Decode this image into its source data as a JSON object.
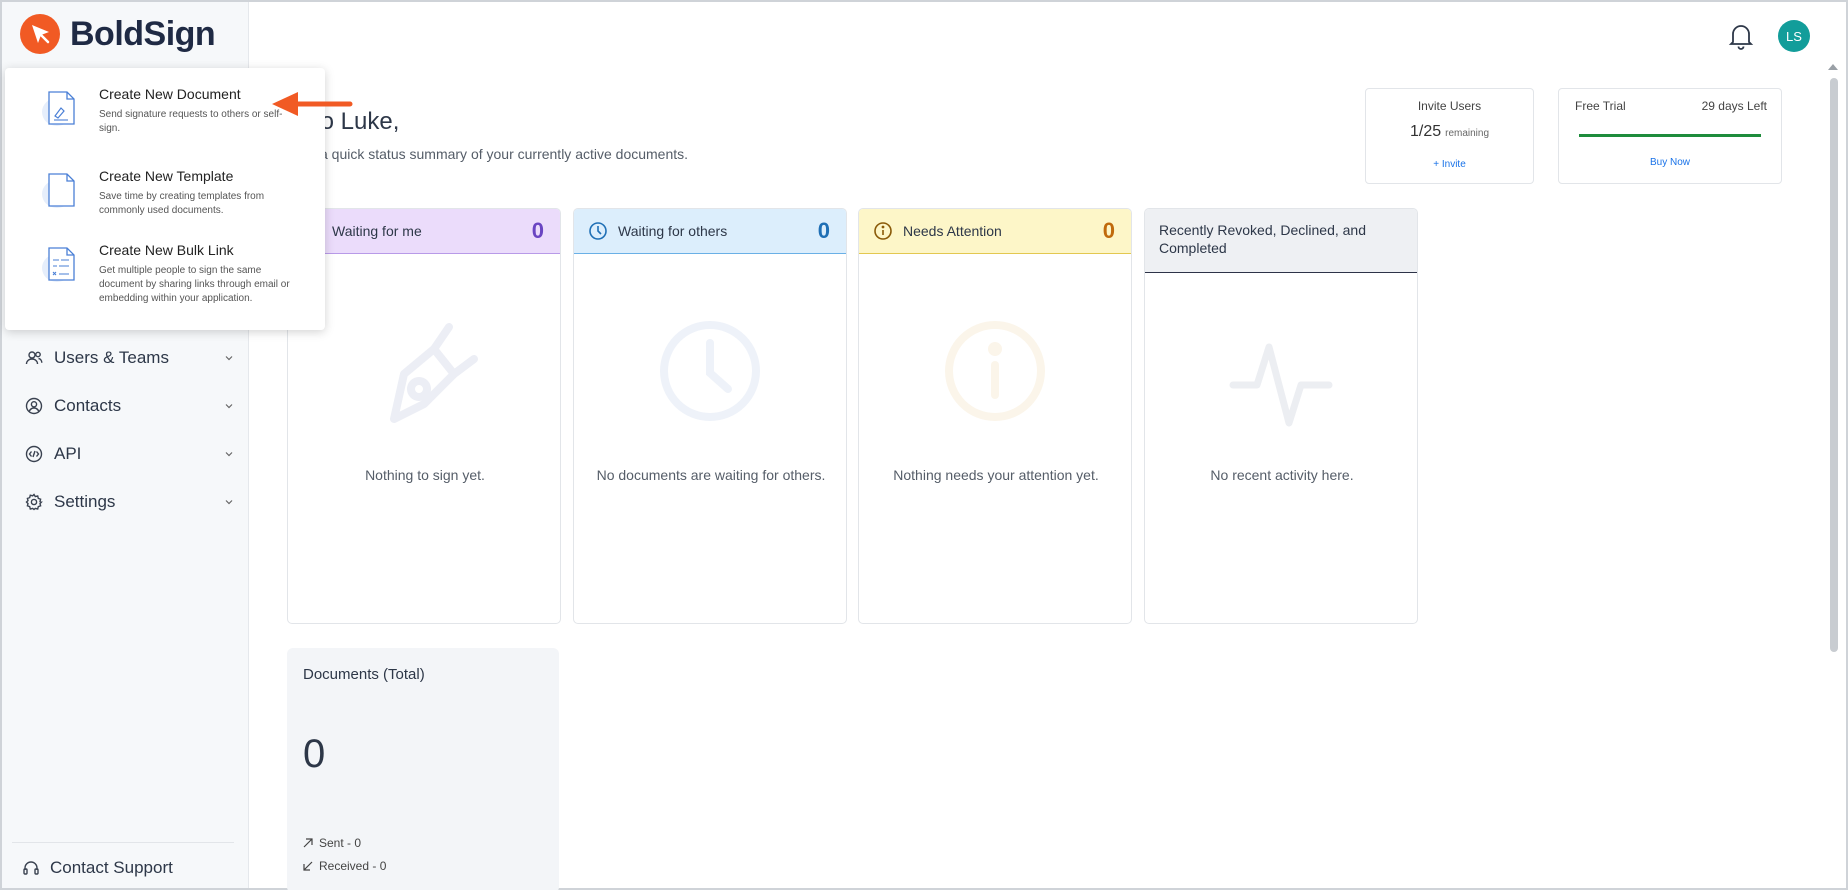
{
  "app": {
    "name": "BoldSign",
    "brand_color": "#f15a24"
  },
  "header": {
    "avatar_initials": "LS",
    "avatar_color": "#129d9a",
    "bell_icon": "bell-icon"
  },
  "create_menu": {
    "items": [
      {
        "title": "Create New Document",
        "desc": "Send signature requests to others or self-sign.",
        "icon": "document-sign-icon"
      },
      {
        "title": "Create New Template",
        "desc": "Save time by creating templates from commonly used documents.",
        "icon": "template-icon"
      },
      {
        "title": "Create New Bulk Link",
        "desc": "Get multiple people to sign the same document by sharing links through email or embedding within your application.",
        "icon": "bulk-link-icon"
      }
    ]
  },
  "sidebar": {
    "items": [
      {
        "label": "Users & Teams",
        "icon": "users-icon"
      },
      {
        "label": "Contacts",
        "icon": "contacts-icon"
      },
      {
        "label": "API",
        "icon": "api-icon"
      },
      {
        "label": "Settings",
        "icon": "gear-icon"
      }
    ],
    "support_label": "Contact Support"
  },
  "greeting": {
    "title": "llo Luke,",
    "subtitle": "is a quick status summary of your currently active documents."
  },
  "invite_users": {
    "title": "Invite Users",
    "count": "1/25",
    "remaining_label": "remaining",
    "invite_link": "+ Invite"
  },
  "free_trial": {
    "title": "Free Trial",
    "days_left": "29 days Left",
    "progress": 1.0,
    "buy_label": "Buy Now"
  },
  "status_cards": [
    {
      "title": "Waiting for me",
      "count": "0",
      "empty": "Nothing to sign yet."
    },
    {
      "title": "Waiting for others",
      "count": "0",
      "empty": "No documents are waiting for others."
    },
    {
      "title": "Needs Attention",
      "count": "0",
      "empty": "Nothing needs your attention yet."
    },
    {
      "title": "Recently Revoked, Declined, and Completed",
      "count": "",
      "empty": "No recent activity here."
    }
  ],
  "documents_total": {
    "title": "Documents (Total)",
    "value": "0",
    "sent": "Sent - 0",
    "received": "Received - 0"
  }
}
